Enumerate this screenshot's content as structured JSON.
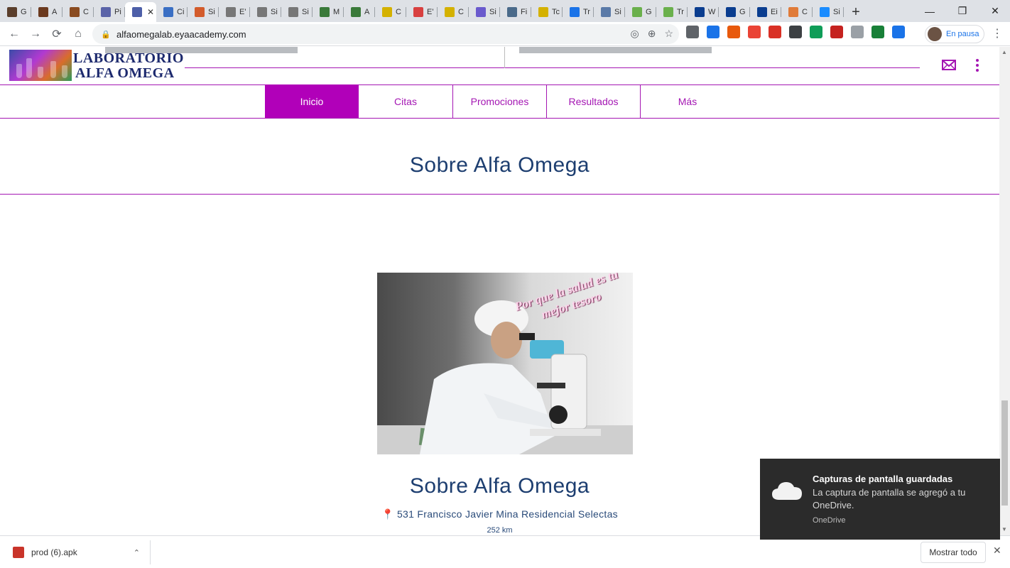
{
  "browser": {
    "tabs": [
      {
        "label": "G",
        "color": "#5a3e2b"
      },
      {
        "label": "A",
        "color": "#6b3a1f"
      },
      {
        "label": "C",
        "color": "#8a4b20"
      },
      {
        "label": "Pi",
        "color": "#5a63a8"
      },
      {
        "label": "",
        "color": "#4d5fa8",
        "active": true,
        "close": "✕"
      },
      {
        "label": "Ci",
        "color": "#3a6fc4"
      },
      {
        "label": "Si",
        "color": "#d35b2b"
      },
      {
        "label": "E'",
        "color": "#777777"
      },
      {
        "label": "Si",
        "color": "#777777"
      },
      {
        "label": "Si",
        "color": "#777777"
      },
      {
        "label": "M",
        "color": "#3a7a3a"
      },
      {
        "label": "A",
        "color": "#3a7a3a"
      },
      {
        "label": "C",
        "color": "#d4b100"
      },
      {
        "label": "E'",
        "color": "#d84040"
      },
      {
        "label": "C",
        "color": "#d4b100"
      },
      {
        "label": "Si",
        "color": "#6a5acd"
      },
      {
        "label": "Fi",
        "color": "#4a6a8a"
      },
      {
        "label": "Tc",
        "color": "#d4b100"
      },
      {
        "label": "Tr",
        "color": "#1a73e8"
      },
      {
        "label": "Si",
        "color": "#5a7aa8"
      },
      {
        "label": "G",
        "color": "#6ab04c"
      },
      {
        "label": "Tr",
        "color": "#6ab04c"
      },
      {
        "label": "W",
        "color": "#0a3d8f"
      },
      {
        "label": "G",
        "color": "#0a3d8f"
      },
      {
        "label": "Ei",
        "color": "#0a3d8f"
      },
      {
        "label": "C",
        "color": "#e07b39"
      },
      {
        "label": "Si",
        "color": "#1a8cff"
      }
    ],
    "new_tab": "+",
    "window_controls": {
      "minimize": "—",
      "maximize": "❐",
      "close": "✕"
    },
    "url": "alfaomegalab.eyaacademy.com",
    "profile_label": "En pausa",
    "extensions": [
      "#5f6368",
      "#1a73e8",
      "#e8590c",
      "#ea4335",
      "#d93025",
      "#3c4043",
      "#0f9d58",
      "#c5221f",
      "#9aa0a6",
      "#188038",
      "#1a73e8"
    ]
  },
  "site": {
    "logo_line1": "LABORATORIO",
    "logo_line2": "ALFA OMEGA",
    "nav": [
      {
        "label": "Inicio",
        "active": true
      },
      {
        "label": "Citas",
        "active": false
      },
      {
        "label": "Promociones",
        "active": false
      },
      {
        "label": "Resultados",
        "active": false
      },
      {
        "label": "Más",
        "active": false
      }
    ],
    "section_title": "Sobre Alfa Omega",
    "hero_slogan": "Por que la salud es tu mejor tesoro",
    "about_title": "Sobre Alfa Omega",
    "address": "531 Francisco Javier Mina Residencial Selectas",
    "distance": "252 km",
    "accent_color": "#b100b9",
    "title_color": "#1d3e70"
  },
  "download_bar": {
    "file_name": "prod (6).apk",
    "show_all": "Mostrar todo",
    "close": "✕"
  },
  "toast": {
    "title": "Capturas de pantalla guardadas",
    "message": "La captura de pantalla se agregó a tu OneDrive.",
    "source": "OneDrive"
  }
}
